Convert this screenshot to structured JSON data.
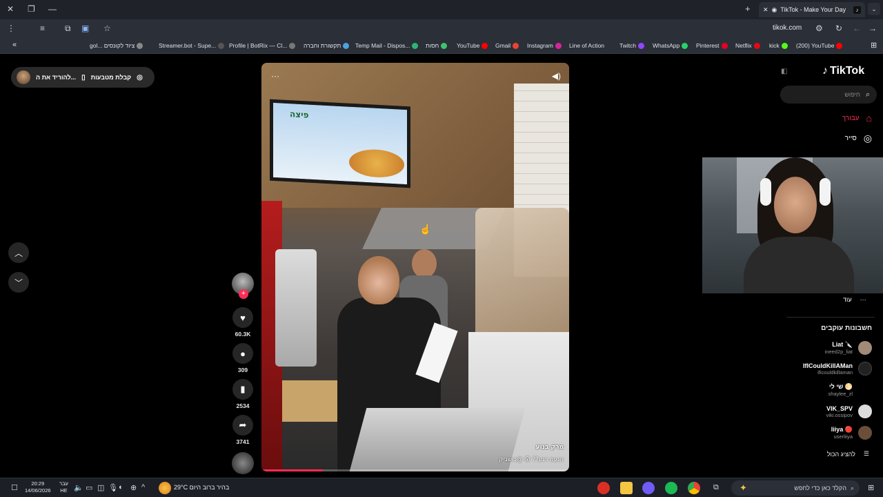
{
  "browser": {
    "tab_title": "TikTok - Make Your Day",
    "url": "tikok.com",
    "bookmarks": [
      {
        "label": "gol... ציוד לקונסים",
        "color": "#888"
      },
      {
        "label": "Streamer.bot - Supe...",
        "color": "#555"
      },
      {
        "label": "Profile | BotRix — Cl...",
        "color": "#777"
      },
      {
        "label": "תקשורת וחברה",
        "color": "#4aa3df"
      },
      {
        "label": "Temp Mail - Dispos...",
        "color": "#2bb673"
      },
      {
        "label": "חסות",
        "color": "#3ec46d"
      },
      {
        "label": "YouTube",
        "color": "#ff0000"
      },
      {
        "label": "Gmail",
        "color": "#ea4335"
      },
      {
        "label": "Instagram",
        "color": "#d6249f"
      },
      {
        "label": "Line of Action",
        "color": "#666"
      },
      {
        "label": "Twitch",
        "color": "#9146ff"
      },
      {
        "label": "WhatsApp",
        "color": "#25d366"
      },
      {
        "label": "Pinterest",
        "color": "#e60023"
      },
      {
        "label": "Netflix",
        "color": "#e50914"
      },
      {
        "label": "kick",
        "color": "#53fc18"
      },
      {
        "label": "(200) YouTube",
        "color": "#ff0000"
      }
    ]
  },
  "left": {
    "pill_label": "קבלת מטבעות",
    "pill_label2": "להוריד את ה...",
    "nav_up": "up-arrow",
    "nav_down": "down-arrow"
  },
  "video": {
    "tv_text": "פיצה",
    "author": "מרק בנוע",
    "caption": "הגעת רגע?? 😮 @כושביק",
    "progress_fraction": 0.2
  },
  "actions": {
    "likes": "60.3K",
    "comments": "309",
    "saves": "2534",
    "shares": "3741"
  },
  "sidebar": {
    "logo": "TikTok",
    "search_placeholder": "חיפוש",
    "nav": [
      {
        "label": "עבורך",
        "icon": "home-icon",
        "color": "#fe2c55"
      },
      {
        "label": "סייר",
        "icon": "compass-icon",
        "color": "#ffffff"
      }
    ],
    "more_label": "עוד",
    "following_title": "חשבונות עוקבים",
    "accounts": [
      {
        "name": "Liat 🔪",
        "handle": "ineed2p_liat",
        "color": "#a08a7a"
      },
      {
        "name": "IfICouldKillAMan",
        "handle": "ificouldkillaman",
        "color": "#222"
      },
      {
        "name": "שי לי 🌕",
        "handle": "shaylee_zl",
        "color": "#000"
      },
      {
        "name": "VIK_SPV",
        "handle": "viki.ossipov",
        "color": "#ddd"
      },
      {
        "name": "liiya 🔴",
        "handle": "userliiya",
        "color": "#6a4e3a"
      }
    ],
    "show_all": "להציג הכול"
  },
  "taskbar": {
    "time": "20:29",
    "date": "14/06/2026",
    "lang_top": "עבר",
    "lang_bottom": "HE",
    "weather": "29°C בהיר ברוב היום",
    "search_placeholder": "הקלד כאן כדי לחפש"
  }
}
